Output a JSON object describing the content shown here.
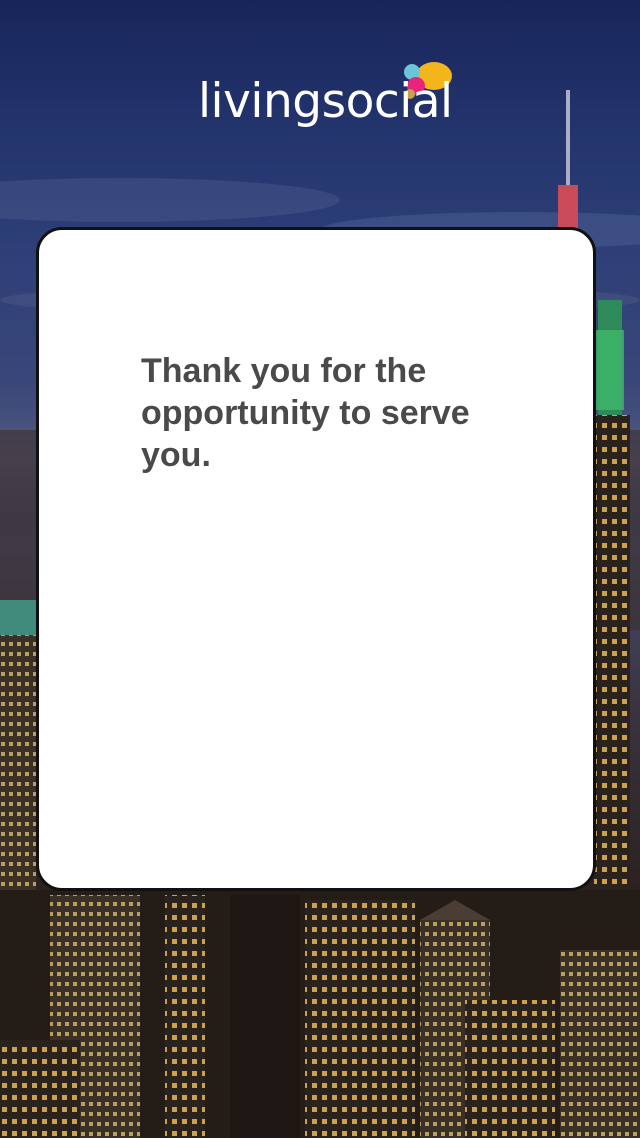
{
  "brand": {
    "name": "livingsocial",
    "logo_colors": [
      "#f2b51c",
      "#e8237a",
      "#6cc4d8",
      "#c8a24a"
    ]
  },
  "card": {
    "message": "Thank you for the opportunity to serve you."
  },
  "background": {
    "description_icon": "city-skyline-background",
    "sky_color": "#1f2d63",
    "light_color": "#f5c46a"
  }
}
